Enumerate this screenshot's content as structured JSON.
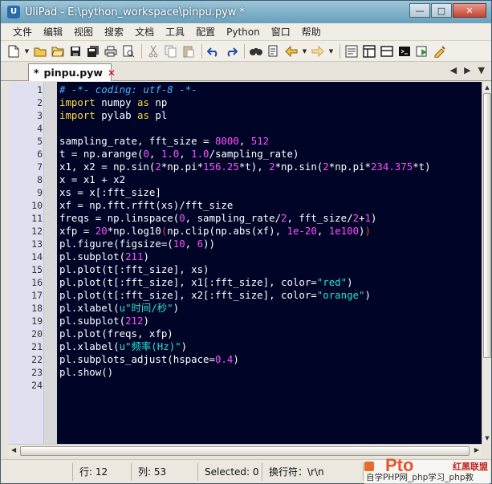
{
  "window": {
    "title": "UliPad - E:\\python_workspace\\pinpu.pyw *",
    "controls": [
      "—",
      "□",
      "✕"
    ]
  },
  "menu": [
    "文件",
    "编辑",
    "视图",
    "搜索",
    "文档",
    "工具",
    "配置",
    "Python",
    "窗口",
    "帮助"
  ],
  "toolbar": {
    "icons": [
      "new-file-icon",
      "open-folder-icon",
      "open-icon",
      "save-icon",
      "save-all-icon",
      "print-icon",
      "print-preview-icon",
      "cut-icon",
      "copy-icon",
      "paste-icon",
      "undo-icon",
      "redo-icon",
      "find-icon",
      "replace-icon",
      "back-icon",
      "forward-icon",
      "properties-icon",
      "layout-icon",
      "window-icon",
      "python-icon",
      "run-icon",
      "tools-icon"
    ]
  },
  "tabs": [
    {
      "label": "pinpu.pyw",
      "modified_marker": "*",
      "active": true
    }
  ],
  "editor": {
    "lines": [
      {
        "n": "1",
        "tokens": [
          {
            "t": "# -*- coding: utf-8 -*-",
            "c": "cm"
          }
        ]
      },
      {
        "n": "2",
        "tokens": [
          {
            "t": "import",
            "c": "kw"
          },
          {
            "t": " numpy ",
            "c": "id"
          },
          {
            "t": "as",
            "c": "kw"
          },
          {
            "t": " np",
            "c": "id"
          }
        ]
      },
      {
        "n": "3",
        "tokens": [
          {
            "t": "import",
            "c": "kw"
          },
          {
            "t": " pylab ",
            "c": "id"
          },
          {
            "t": "as",
            "c": "kw"
          },
          {
            "t": " pl",
            "c": "id"
          }
        ]
      },
      {
        "n": "4",
        "tokens": []
      },
      {
        "n": "5",
        "tokens": [
          {
            "t": "sampling_rate, fft_size = ",
            "c": "id"
          },
          {
            "t": "8000",
            "c": "nm"
          },
          {
            "t": ", ",
            "c": "id"
          },
          {
            "t": "512",
            "c": "nm"
          }
        ]
      },
      {
        "n": "6",
        "tokens": [
          {
            "t": "t = np.arange(",
            "c": "id"
          },
          {
            "t": "0",
            "c": "nm"
          },
          {
            "t": ", ",
            "c": "id"
          },
          {
            "t": "1.0",
            "c": "nm"
          },
          {
            "t": ", ",
            "c": "id"
          },
          {
            "t": "1.0",
            "c": "nm"
          },
          {
            "t": "/sampling_rate)",
            "c": "id"
          }
        ]
      },
      {
        "n": "7",
        "tokens": [
          {
            "t": "x1, x2 = np.sin(",
            "c": "id"
          },
          {
            "t": "2",
            "c": "nm"
          },
          {
            "t": "*np.pi*",
            "c": "id"
          },
          {
            "t": "156.25",
            "c": "nm"
          },
          {
            "t": "*t), ",
            "c": "id"
          },
          {
            "t": "2",
            "c": "nm"
          },
          {
            "t": "*np.sin(",
            "c": "id"
          },
          {
            "t": "2",
            "c": "nm"
          },
          {
            "t": "*np.pi*",
            "c": "id"
          },
          {
            "t": "234.375",
            "c": "nm"
          },
          {
            "t": "*t)",
            "c": "id"
          }
        ]
      },
      {
        "n": "8",
        "tokens": [
          {
            "t": "x = x1 + x2",
            "c": "id"
          }
        ]
      },
      {
        "n": "9",
        "tokens": [
          {
            "t": "xs = x[:fft_size]",
            "c": "id"
          }
        ]
      },
      {
        "n": "10",
        "tokens": [
          {
            "t": "xf = np.fft.rfft(xs)/fft_size",
            "c": "id"
          }
        ]
      },
      {
        "n": "11",
        "tokens": [
          {
            "t": "freqs = np.linspace(",
            "c": "id"
          },
          {
            "t": "0",
            "c": "nm"
          },
          {
            "t": ", sampling_rate/",
            "c": "id"
          },
          {
            "t": "2",
            "c": "nm"
          },
          {
            "t": ", fft_size/",
            "c": "id"
          },
          {
            "t": "2",
            "c": "nm"
          },
          {
            "t": "+",
            "c": "id"
          },
          {
            "t": "1",
            "c": "nm"
          },
          {
            "t": ")",
            "c": "id"
          }
        ]
      },
      {
        "n": "12",
        "tokens": [
          {
            "t": "xfp = ",
            "c": "id"
          },
          {
            "t": "20",
            "c": "nm"
          },
          {
            "t": "*np.log10",
            "c": "id"
          },
          {
            "t": "(",
            "c": "br"
          },
          {
            "t": "np.clip(np.abs(xf), ",
            "c": "id"
          },
          {
            "t": "1e-20",
            "c": "nm"
          },
          {
            "t": ", ",
            "c": "id"
          },
          {
            "t": "1e100",
            "c": "nm"
          },
          {
            "t": ")",
            "c": "id"
          },
          {
            "t": ")",
            "c": "br"
          }
        ]
      },
      {
        "n": "13",
        "tokens": [
          {
            "t": "pl.figure(figsize=(",
            "c": "id"
          },
          {
            "t": "10",
            "c": "nm"
          },
          {
            "t": ", ",
            "c": "id"
          },
          {
            "t": "6",
            "c": "nm"
          },
          {
            "t": "))",
            "c": "id"
          }
        ]
      },
      {
        "n": "14",
        "tokens": [
          {
            "t": "pl.subplot(",
            "c": "id"
          },
          {
            "t": "211",
            "c": "nm"
          },
          {
            "t": ")",
            "c": "id"
          }
        ]
      },
      {
        "n": "15",
        "tokens": [
          {
            "t": "pl.plot(t[:fft_size], xs)",
            "c": "id"
          }
        ]
      },
      {
        "n": "16",
        "tokens": [
          {
            "t": "pl.plot(t[:fft_size], x1[:fft_size], color=",
            "c": "id"
          },
          {
            "t": "\"red\"",
            "c": "st"
          },
          {
            "t": ")",
            "c": "id"
          }
        ]
      },
      {
        "n": "17",
        "tokens": [
          {
            "t": "pl.plot(t[:fft_size], x2[:fft_size], color=",
            "c": "id"
          },
          {
            "t": "\"orange\"",
            "c": "st"
          },
          {
            "t": ")",
            "c": "id"
          }
        ]
      },
      {
        "n": "18",
        "tokens": [
          {
            "t": "pl.xlabel(",
            "c": "id"
          },
          {
            "t": "u\"时间/秒\"",
            "c": "st"
          },
          {
            "t": ")",
            "c": "id"
          }
        ]
      },
      {
        "n": "19",
        "tokens": [
          {
            "t": "pl.subplot(",
            "c": "id"
          },
          {
            "t": "212",
            "c": "nm"
          },
          {
            "t": ")",
            "c": "id"
          }
        ]
      },
      {
        "n": "20",
        "tokens": [
          {
            "t": "pl.plot(freqs, xfp)",
            "c": "id"
          }
        ]
      },
      {
        "n": "21",
        "tokens": [
          {
            "t": "pl.xlabel(",
            "c": "id"
          },
          {
            "t": "u\"频率(Hz)\"",
            "c": "st"
          },
          {
            "t": ")",
            "c": "id"
          }
        ]
      },
      {
        "n": "22",
        "tokens": [
          {
            "t": "pl.subplots_adjust(hspace=",
            "c": "id"
          },
          {
            "t": "0.4",
            "c": "nm"
          },
          {
            "t": ")",
            "c": "id"
          }
        ]
      },
      {
        "n": "23",
        "tokens": [
          {
            "t": "pl.show()",
            "c": "id"
          }
        ]
      },
      {
        "n": "24",
        "tokens": []
      }
    ]
  },
  "status": {
    "row": "行: 12",
    "col": "列: 53",
    "selected": "Selected: 0",
    "newline": "换行符：\\r\\n"
  },
  "watermark": {
    "big": "Pto",
    "red": "红黑联盟",
    "sub": "自学PHP网_php学习_php教"
  },
  "colors": {
    "editor_bg": "#000527",
    "comment": "#4ab3ff",
    "keyword": "#ffd838",
    "number": "#ff4dfd",
    "string": "#22e3d3",
    "brace_match": "#ff3b3b"
  }
}
